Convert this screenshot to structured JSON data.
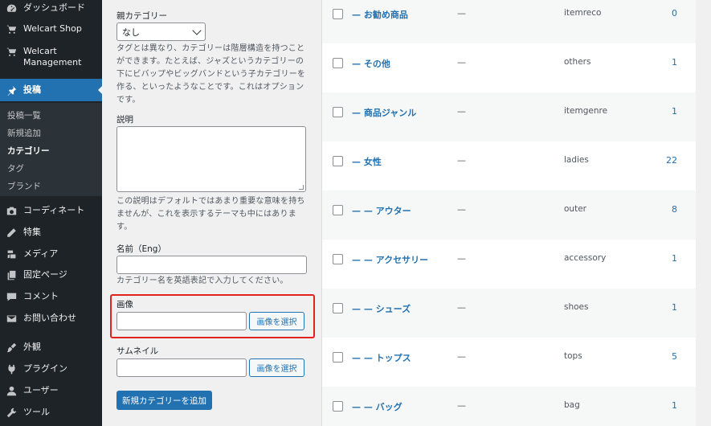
{
  "sidebar": {
    "top_items": [
      {
        "label": "ダッシュボード",
        "icon": "dashboard-icon"
      },
      {
        "label": "Welcart Shop",
        "icon": "cart-icon"
      },
      {
        "label": "Welcart\nManagement",
        "icon": "cart-icon"
      },
      {
        "label": "投稿",
        "icon": "pushpin-icon",
        "active": true
      }
    ],
    "submenu": [
      {
        "label": "投稿一覧"
      },
      {
        "label": "新規追加"
      },
      {
        "label": "カテゴリー",
        "current": true
      },
      {
        "label": "タグ"
      },
      {
        "label": "ブランド"
      }
    ],
    "bottom_items": [
      {
        "label": "コーディネート",
        "icon": "camera-icon"
      },
      {
        "label": "特集",
        "icon": "pencil-icon"
      },
      {
        "label": "メディア",
        "icon": "media-icon"
      },
      {
        "label": "固定ページ",
        "icon": "page-icon"
      },
      {
        "label": "コメント",
        "icon": "comment-icon"
      },
      {
        "label": "お問い合わせ",
        "icon": "mail-icon"
      },
      {
        "label": "外観",
        "icon": "appearance-icon"
      },
      {
        "label": "プラグイン",
        "icon": "plugin-icon"
      },
      {
        "label": "ユーザー",
        "icon": "user-icon"
      },
      {
        "label": "ツール",
        "icon": "wrench-icon"
      }
    ]
  },
  "form": {
    "parent_label": "親カテゴリー",
    "parent_value": "なし",
    "parent_help": "タグとは異なり、カテゴリーは階層構造を持つことができます。たとえば、ジャズというカテゴリーの下にビバップやビッグバンドという子カテゴリーを作る、といったようなことです。これはオプションです。",
    "description_label": "説明",
    "description_help": "この説明はデフォルトではあまり重要な意味を持ちませんが、これを表示するテーマも中にはあります。",
    "name_eng_label": "名前（Eng）",
    "name_eng_help": "カテゴリー名を英語表記で入力してください。",
    "image_label": "画像",
    "image_button": "画像を選択",
    "thumbnail_label": "サムネイル",
    "thumbnail_button": "画像を選択",
    "submit_button": "新規カテゴリーを追加"
  },
  "categories": [
    {
      "name": "— お勧め商品",
      "description": "—",
      "slug": "itemreco",
      "count": "0"
    },
    {
      "name": "— その他",
      "description": "—",
      "slug": "others",
      "count": "1"
    },
    {
      "name": "— 商品ジャンル",
      "description": "—",
      "slug": "itemgenre",
      "count": "1"
    },
    {
      "name": "— 女性",
      "description": "—",
      "slug": "ladies",
      "count": "22"
    },
    {
      "name": "— — アウター",
      "description": "—",
      "slug": "outer",
      "count": "8"
    },
    {
      "name": "— — アクセサリー",
      "description": "—",
      "slug": "accessory",
      "count": "1"
    },
    {
      "name": "— — シューズ",
      "description": "—",
      "slug": "shoes",
      "count": "1"
    },
    {
      "name": "— — トップス",
      "description": "—",
      "slug": "tops",
      "count": "5"
    },
    {
      "name": "— — バッグ",
      "description": "—",
      "slug": "bag",
      "count": "1"
    }
  ],
  "colors": {
    "admin_sidebar": "#1d2327",
    "accent": "#2271b1",
    "highlight_border": "#e3221c"
  }
}
